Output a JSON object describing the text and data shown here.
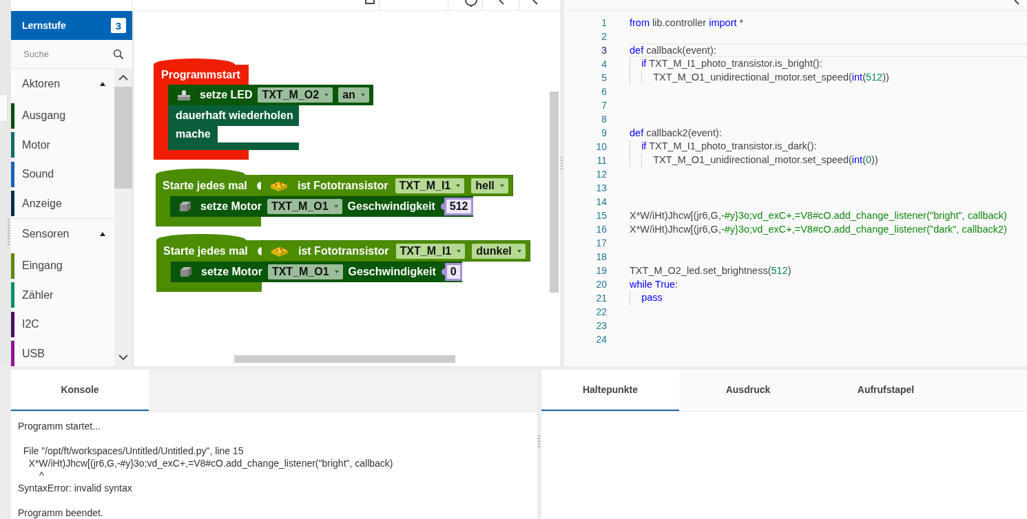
{
  "sidebar": {
    "header": {
      "title": "Lernstufe",
      "badge": "3"
    },
    "search": {
      "placeholder": "Suche"
    },
    "groups": [
      {
        "label": "Aktoren",
        "expanded": true,
        "items": [
          {
            "label": "Ausgang",
            "color": "#0b4d0b"
          },
          {
            "label": "Motor",
            "color": "#0e6e66"
          },
          {
            "label": "Sound",
            "color": "#1565b0"
          },
          {
            "label": "Anzeige",
            "color": "#0c2d4e"
          }
        ]
      },
      {
        "label": "Sensoren",
        "expanded": true,
        "items": [
          {
            "label": "Eingang",
            "color": "#5a8a00"
          },
          {
            "label": "Zähler",
            "color": "#0d8f6c"
          },
          {
            "label": "I2C",
            "color": "#4a0c5a"
          },
          {
            "label": "USB",
            "color": "#8c1496"
          }
        ]
      }
    ]
  },
  "workspace": {
    "blocks": [
      {
        "kind": "start",
        "label": "Programmstart",
        "color": "#f01e00",
        "statements": [
          {
            "kind": "led_action",
            "color": "#0a560a",
            "parts": [
              {
                "kind": "text",
                "text": "setze LED"
              },
              {
                "kind": "dropdown",
                "text": "TXT_M_O2"
              },
              {
                "kind": "dropdown",
                "text": "an"
              }
            ]
          },
          {
            "kind": "loop",
            "color": "#0b5e3c",
            "label": "dauerhaft wiederholen",
            "do_label": "mache"
          }
        ]
      },
      {
        "kind": "event",
        "label": "Starte jedes mal",
        "color": "#4c8c00",
        "condition": {
          "parts": [
            {
              "kind": "text",
              "text": "ist Fototransistor"
            },
            {
              "kind": "dropdown",
              "text": "TXT_M_I1"
            },
            {
              "kind": "dropdown",
              "text": "hell"
            }
          ]
        },
        "statements": [
          {
            "kind": "motor_action",
            "color": "#0a560a",
            "parts": [
              {
                "kind": "text",
                "text": "setze Motor"
              },
              {
                "kind": "dropdown",
                "text": "TXT_M_O1"
              },
              {
                "kind": "text",
                "text": "Geschwindigkeit"
              },
              {
                "kind": "number",
                "text": "512"
              }
            ]
          }
        ]
      },
      {
        "kind": "event",
        "label": "Starte jedes mal",
        "color": "#4c8c00",
        "condition": {
          "parts": [
            {
              "kind": "text",
              "text": "ist Fototransistor"
            },
            {
              "kind": "dropdown",
              "text": "TXT_M_I1"
            },
            {
              "kind": "dropdown",
              "text": "dunkel"
            }
          ]
        },
        "statements": [
          {
            "kind": "motor_action",
            "color": "#0a560a",
            "parts": [
              {
                "kind": "text",
                "text": "setze Motor"
              },
              {
                "kind": "dropdown",
                "text": "TXT_M_O1"
              },
              {
                "kind": "text",
                "text": "Geschwindigkeit"
              },
              {
                "kind": "number",
                "text": "0"
              }
            ]
          }
        ]
      }
    ]
  },
  "editor": {
    "lines": [
      {
        "number": "1",
        "selected": false,
        "tokens": [
          {
            "kind": "kw",
            "text": "from"
          },
          {
            "kind": "plain",
            "text": " lib.controller "
          },
          {
            "kind": "kw",
            "text": "import"
          },
          {
            "kind": "plain",
            "text": " *"
          }
        ]
      },
      {
        "number": "2",
        "selected": false
      },
      {
        "number": "3",
        "selected": true,
        "tokens": [
          {
            "kind": "kw",
            "text": "def"
          },
          {
            "kind": "plain",
            "text": " callback(event):"
          }
        ]
      },
      {
        "number": "4",
        "selected": false,
        "tokens": [
          {
            "kind": "kw",
            "text": "    if"
          },
          {
            "kind": "plain",
            "text": " TXT_M_I1_photo_transistor.is_bright():"
          }
        ]
      },
      {
        "number": "5",
        "selected": false,
        "tokens": [
          {
            "kind": "plain",
            "text": "        TXT_M_O1_unidirectional_motor.set_speed("
          },
          {
            "kind": "kw",
            "text": "int"
          },
          {
            "kind": "plain",
            "text": "("
          },
          {
            "kind": "num",
            "text": "512"
          },
          {
            "kind": "plain",
            "text": "))"
          }
        ]
      },
      {
        "number": "6",
        "selected": false
      },
      {
        "number": "7",
        "selected": false
      },
      {
        "number": "8",
        "selected": false
      },
      {
        "number": "9",
        "selected": false,
        "tokens": [
          {
            "kind": "kw",
            "text": "def"
          },
          {
            "kind": "plain",
            "text": " callback2(event):"
          }
        ]
      },
      {
        "number": "10",
        "selected": false,
        "tokens": [
          {
            "kind": "kw",
            "text": "    if"
          },
          {
            "kind": "plain",
            "text": " TXT_M_I1_photo_transistor.is_dark():"
          }
        ]
      },
      {
        "number": "11",
        "selected": false,
        "tokens": [
          {
            "kind": "plain",
            "text": "        TXT_M_O1_unidirectional_motor.set_speed("
          },
          {
            "kind": "kw",
            "text": "int"
          },
          {
            "kind": "plain",
            "text": "("
          },
          {
            "kind": "num",
            "text": "0"
          },
          {
            "kind": "plain",
            "text": "))"
          }
        ]
      },
      {
        "number": "12",
        "selected": false
      },
      {
        "number": "13",
        "selected": false
      },
      {
        "number": "14",
        "selected": false
      },
      {
        "number": "15",
        "selected": false,
        "tokens": [
          {
            "kind": "plain",
            "text": "X*W/iHt)Jhcw[(jr6,G,"
          },
          {
            "kind": "str",
            "text": "-#y}3o;vd_exC+,=V8#cO.add_change_listener(\"bright\", callback)"
          }
        ]
      },
      {
        "number": "16",
        "selected": false,
        "tokens": [
          {
            "kind": "plain",
            "text": "X*W/iHt)Jhcw[(jr6,G,"
          },
          {
            "kind": "str",
            "text": "-#y}3o;vd_exC+,=V8#cO.add_change_listener(\"dark\", callback2)"
          }
        ]
      },
      {
        "number": "17",
        "selected": false
      },
      {
        "number": "18",
        "selected": false
      },
      {
        "number": "19",
        "selected": false,
        "tokens": [
          {
            "kind": "plain",
            "text": "TXT_M_O2_led.set_brightness("
          },
          {
            "kind": "num",
            "text": "512"
          },
          {
            "kind": "plain",
            "text": ")"
          }
        ]
      },
      {
        "number": "20",
        "selected": false,
        "tokens": [
          {
            "kind": "kw",
            "text": "while True"
          },
          {
            "kind": "plain",
            "text": ":"
          }
        ]
      },
      {
        "number": "21",
        "selected": false,
        "tokens": [
          {
            "kind": "kw",
            "text": "    pass"
          }
        ]
      },
      {
        "number": "22",
        "selected": false
      },
      {
        "number": "23",
        "selected": false
      },
      {
        "number": "24",
        "selected": false
      }
    ]
  },
  "console": {
    "tabs": [
      {
        "label": "Konsole",
        "selected": true
      }
    ],
    "output": [
      "Programm startet...",
      "  File \"/opt/ft/workspaces/Untitled/Untitled.py\", line 15\n    X*W/iHt)Jhcw[(jr6,G,-#y}3o;vd_exC+,=V8#cO.add_change_listener(\"bright\", callback)\n        ^\nSyntaxError: invalid syntax",
      "Programm beendet."
    ]
  },
  "debugger": {
    "tabs": [
      {
        "label": "Haltepunkte",
        "selected": true
      },
      {
        "label": "Ausdruck",
        "selected": false
      },
      {
        "label": "Aufrufstapel",
        "selected": false
      }
    ]
  }
}
